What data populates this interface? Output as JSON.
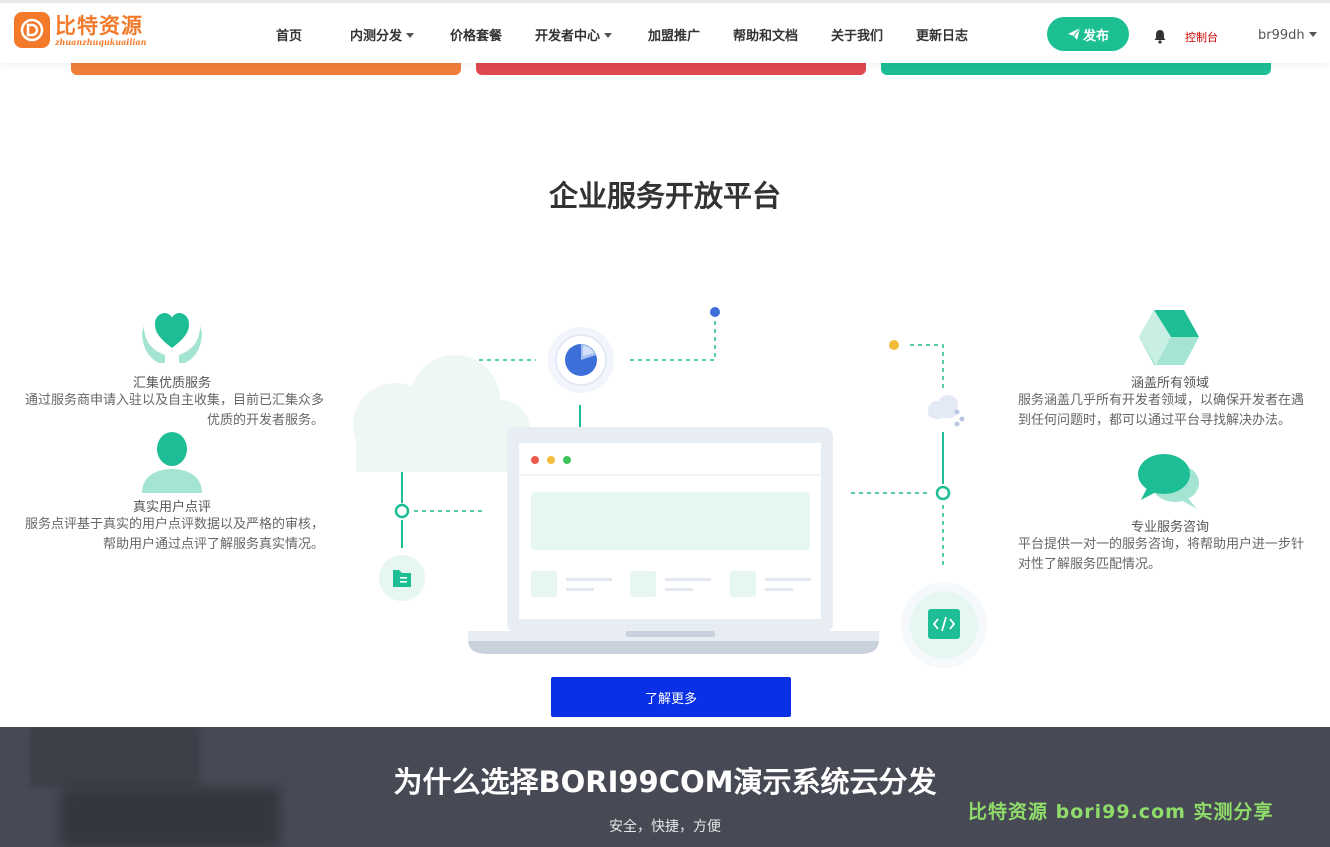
{
  "brand": {
    "name": "比特资源",
    "tagline": "zhuanzhuqukuailian",
    "color": "#f47a2b"
  },
  "nav": {
    "items": [
      {
        "label": "首页",
        "dropdown": false
      },
      {
        "label": "内测分发",
        "dropdown": true
      },
      {
        "label": "价格套餐",
        "dropdown": false
      },
      {
        "label": "开发者中心",
        "dropdown": true
      },
      {
        "label": "加盟推广",
        "dropdown": false
      },
      {
        "label": "帮助和文档",
        "dropdown": false
      },
      {
        "label": "关于我们",
        "dropdown": false
      },
      {
        "label": "更新日志",
        "dropdown": false
      }
    ],
    "publish_label": "发布",
    "console_label": "控制台",
    "user_label": "br99dh",
    "accent": "#1cbf92"
  },
  "strip_colors": [
    "#f07d3a",
    "#e0464f",
    "#1dbd96"
  ],
  "section": {
    "title": "企业服务开放平台",
    "features": [
      {
        "icon": "heart-hands-icon",
        "title": "汇集优质服务",
        "desc": "通过服务商申请入驻以及自主收集，目前已汇集众多优质的开发者服务。"
      },
      {
        "icon": "user-icon",
        "title": "真实用户点评",
        "desc": "服务点评基于真实的用户点评数据以及严格的审核，帮助用户通过点评了解服务真实情况。"
      },
      {
        "icon": "cube-icon",
        "title": "涵盖所有领域",
        "desc": "服务涵盖几乎所有开发者领域，以确保开发者在遇到任何问题时，都可以通过平台寻找解决办法。"
      },
      {
        "icon": "chat-bubbles-icon",
        "title": "专业服务咨询",
        "desc": "平台提供一对一的服务咨询，将帮助用户进一步针对性了解服务匹配情况。"
      }
    ],
    "cta_label": "了解更多",
    "cta_color": "#0a30e6"
  },
  "why": {
    "title": "为什么选择BORI99COM演示系统云分发",
    "subtitle": "安全，快捷，方便"
  },
  "watermark": "比特资源 bori99.com 实测分享"
}
